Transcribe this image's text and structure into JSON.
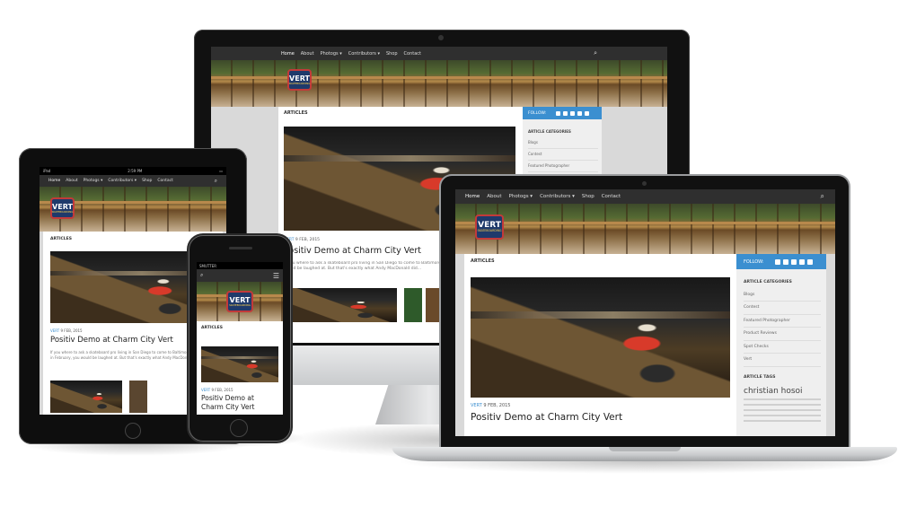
{
  "site": {
    "nav": [
      "Home",
      "About",
      "Photogs ▾",
      "Contributors ▾",
      "Shop",
      "Contact"
    ],
    "logo": "VERT",
    "logo_sub": "SKATEBOARDING",
    "section_title": "ARTICLES",
    "follow_label": "FOLLOW:",
    "article": {
      "category": "VERT",
      "date": "9 FEB, 2015",
      "title": "Positiv Demo at Charm City Vert",
      "excerpt": "If you where to ask a skateboard pro living in San Diego to come to Baltimore to do a demo in February, you would be laughed at. But that's exactly what Andy MacDonald did…"
    },
    "sidebar": {
      "categories_heading": "ARTICLE CATEGORIES",
      "categories": [
        "Blogs",
        "Contest",
        "Featured Photographer",
        "Product Reviews",
        "Spot Checks",
        "Vert"
      ],
      "tags_heading": "ARTICLE TAGS",
      "tag_featured": "christian hosoi"
    }
  },
  "ipad_status": {
    "left": "iPad",
    "time": "2:59 PM"
  },
  "iphone_status": {
    "carrier": "SMUTTER",
    "time": ""
  },
  "icons": {
    "search": "search-icon",
    "menu": "hamburger-menu-icon",
    "social": [
      "facebook-icon",
      "twitter-icon",
      "vimeo-icon",
      "instagram-icon",
      "email-icon"
    ]
  },
  "colors": {
    "accent": "#3b8fd0",
    "nav_bg": "#2f2f2f",
    "device_black": "#111111",
    "laptop_silver": "#c9cbcd"
  }
}
